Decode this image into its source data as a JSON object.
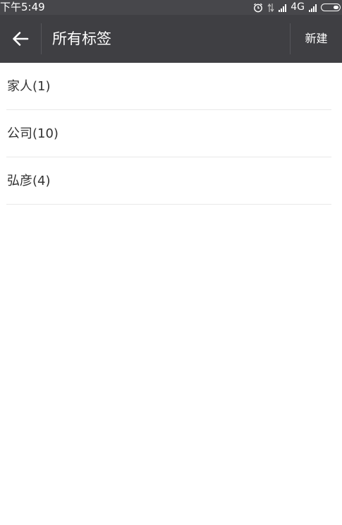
{
  "status_bar": {
    "time": "下午5:49",
    "network": "4G"
  },
  "app_bar": {
    "title": "所有标签",
    "new_label": "新建"
  },
  "tags": [
    {
      "label": "家人(1)"
    },
    {
      "label": "公司(10)"
    },
    {
      "label": "弘彦(4)"
    }
  ]
}
